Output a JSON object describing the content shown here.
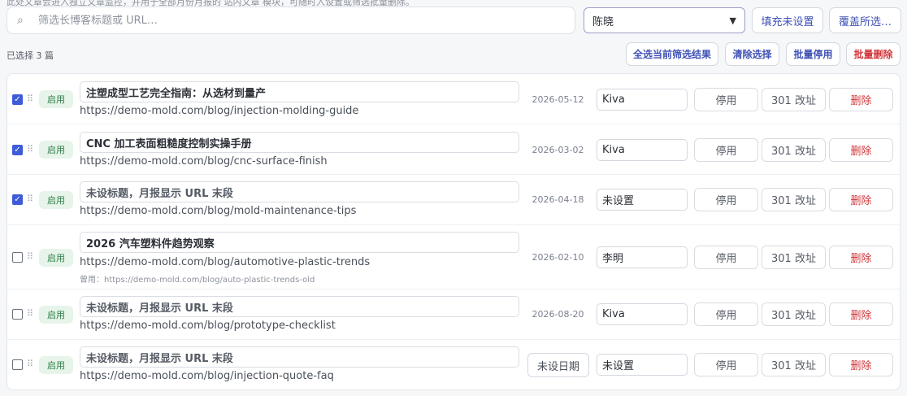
{
  "top_note": "此处文章会进入独立文章监控，并用于全部月份月报的 站内文章 模块，可随时入设置或筛选批量删除。",
  "search": {
    "placeholder": "筛选长博客标题或 URL…",
    "value": ""
  },
  "owner_filter": {
    "selected": "陈晓"
  },
  "toolbar": {
    "fill_unset": "填充未设置",
    "override_selected": "覆盖所选…",
    "selected_count": "已选择 3 篇",
    "select_all_filtered": "全选当前筛选结果",
    "clear_selection": "清除选择",
    "batch_disable": "批量停用",
    "batch_delete": "批量删除"
  },
  "actions": {
    "disable": "停用",
    "redirect": "301 改址",
    "delete": "删除"
  },
  "rows": [
    {
      "checked": true,
      "status": "启用",
      "title": "注塑成型工艺完全指南：从选材到量产",
      "url": "https://demo-mold.com/blog/injection-molding-guide",
      "old_url": "",
      "date": "2026-05-12",
      "owner": "Kiva"
    },
    {
      "checked": true,
      "status": "启用",
      "title": "CNC 加工表面粗糙度控制实操手册",
      "url": "https://demo-mold.com/blog/cnc-surface-finish",
      "old_url": "",
      "date": "2026-03-02",
      "owner": "Kiva"
    },
    {
      "checked": true,
      "status": "启用",
      "title": "未设标题，月报显示 URL 末段",
      "url": "https://demo-mold.com/blog/mold-maintenance-tips",
      "old_url": "",
      "date": "2026-04-18",
      "owner": "未设置"
    },
    {
      "checked": false,
      "status": "启用",
      "title": "2026 汽车塑料件趋势观察",
      "url": "https://demo-mold.com/blog/automotive-plastic-trends",
      "old_url": "曾用：https://demo-mold.com/blog/auto-plastic-trends-old",
      "date": "2026-02-10",
      "owner": "李明"
    },
    {
      "checked": false,
      "status": "启用",
      "title": "未设标题，月报显示 URL 末段",
      "url": "https://demo-mold.com/blog/prototype-checklist",
      "old_url": "",
      "date": "2026-08-20",
      "owner": "Kiva"
    },
    {
      "checked": false,
      "status": "启用",
      "title": "未设标题，月报显示 URL 末段",
      "url": "https://demo-mold.com/blog/injection-quote-faq",
      "old_url": "",
      "date": "未设日期",
      "owner": "未设置"
    }
  ],
  "icons": {
    "search": "search-icon",
    "caret": "chevron-down-icon",
    "drag": "drag-handle-icon",
    "check": "checkmark-icon"
  },
  "colors": {
    "accent": "#3f51b5",
    "danger": "#d0363a",
    "status_bg": "#e6f4ea",
    "status_fg": "#2e7d46",
    "checkbox_on": "#3e5bd8"
  }
}
